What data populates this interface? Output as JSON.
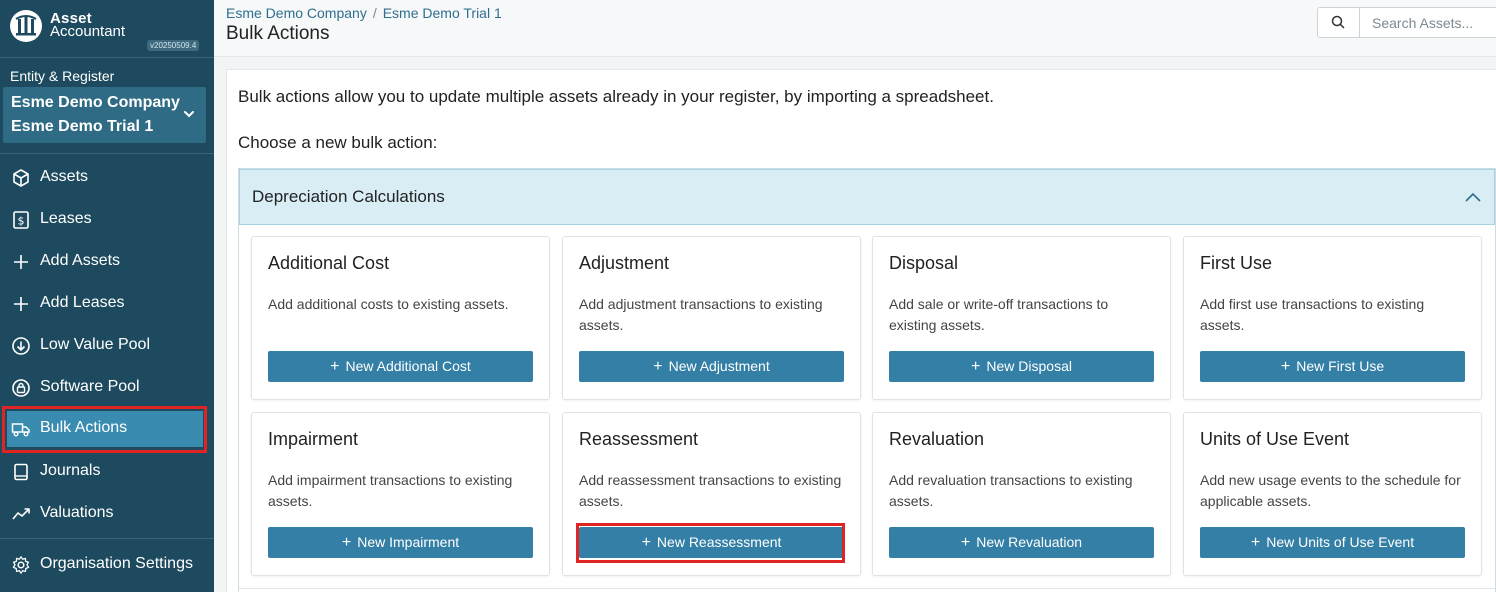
{
  "app": {
    "name_line1": "Asset",
    "name_line2": "Accountant",
    "version": "v20250509.4"
  },
  "sidebar": {
    "entity_label": "Entity & Register",
    "entity_name": "Esme Demo Company",
    "register_name": "Esme Demo Trial 1",
    "items": [
      {
        "label": "Assets",
        "icon": "cube-icon"
      },
      {
        "label": "Leases",
        "icon": "dollar-document-icon"
      },
      {
        "label": "Add Assets",
        "icon": "plus-icon"
      },
      {
        "label": "Add Leases",
        "icon": "plus-icon"
      },
      {
        "label": "Low Value Pool",
        "icon": "down-circle-icon"
      },
      {
        "label": "Software Pool",
        "icon": "lock-circle-icon"
      },
      {
        "label": "Bulk Actions",
        "icon": "truck-icon",
        "active": true
      },
      {
        "label": "Journals",
        "icon": "book-icon"
      },
      {
        "label": "Valuations",
        "icon": "trend-icon"
      },
      {
        "label": "Organisation Settings",
        "icon": "gear-icon"
      }
    ]
  },
  "header": {
    "breadcrumb": [
      "Esme Demo Company",
      "Esme Demo Trial 1"
    ],
    "separator": "/",
    "title": "Bulk Actions",
    "search_placeholder": "Search Assets..."
  },
  "main": {
    "intro": "Bulk actions allow you to update multiple assets already in your register, by importing a spreadsheet.",
    "choose_label": "Choose a new bulk action:",
    "section_title": "Depreciation Calculations",
    "cards": [
      {
        "title": "Additional Cost",
        "desc": "Add additional costs to existing assets.",
        "button": "New Additional Cost"
      },
      {
        "title": "Adjustment",
        "desc": "Add adjustment transactions to existing assets.",
        "button": "New Adjustment"
      },
      {
        "title": "Disposal",
        "desc": "Add sale or write-off transactions to existing assets.",
        "button": "New Disposal"
      },
      {
        "title": "First Use",
        "desc": "Add first use transactions to existing assets.",
        "button": "New First Use"
      },
      {
        "title": "Impairment",
        "desc": "Add impairment transactions to existing assets.",
        "button": "New Impairment"
      },
      {
        "title": "Reassessment",
        "desc": "Add reassessment transactions to existing assets.",
        "button": "New Reassessment"
      },
      {
        "title": "Revaluation",
        "desc": "Add revaluation transactions to existing assets.",
        "button": "New Revaluation"
      },
      {
        "title": "Units of Use Event",
        "desc": "Add new usage events to the schedule for applicable assets.",
        "button": "New Units of Use Event"
      }
    ]
  },
  "colors": {
    "sidebar_bg": "#1d4a5e",
    "active_item": "#3a8bb0",
    "button": "#337fa5",
    "accordion_header": "#d9edf5",
    "highlight": "#e02424"
  }
}
